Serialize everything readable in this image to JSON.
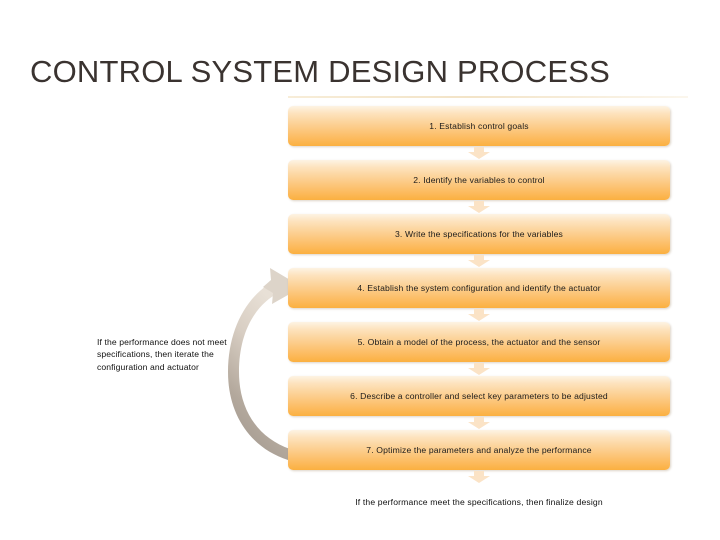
{
  "slide": {
    "title": "CONTROL SYSTEM DESIGN PROCESS",
    "accent_color": "#fbb040",
    "title_color": "#3a3330",
    "background_color": "#ffffff",
    "arrow_color": "#fbe3c6",
    "feedback_arrow_color": "#b7aca1"
  },
  "flow": {
    "steps": [
      {
        "label": "1. Establish control goals"
      },
      {
        "label": "2. Identify the variables to control"
      },
      {
        "label": "3. Write the specifications for the variables"
      },
      {
        "label": "4. Establish the system configuration and identify the actuator"
      },
      {
        "label": "5. Obtain a model of the process, the actuator and the sensor"
      },
      {
        "label": "6. Describe a controller and select key parameters to be adjusted"
      },
      {
        "label": "7. Optimize the parameters and analyze the performance"
      }
    ],
    "closing_text": "If the performance meet the specifications, then finalize design"
  },
  "feedback": {
    "note": "If the performance does not meet specifications, then iterate the configuration and actuator"
  }
}
